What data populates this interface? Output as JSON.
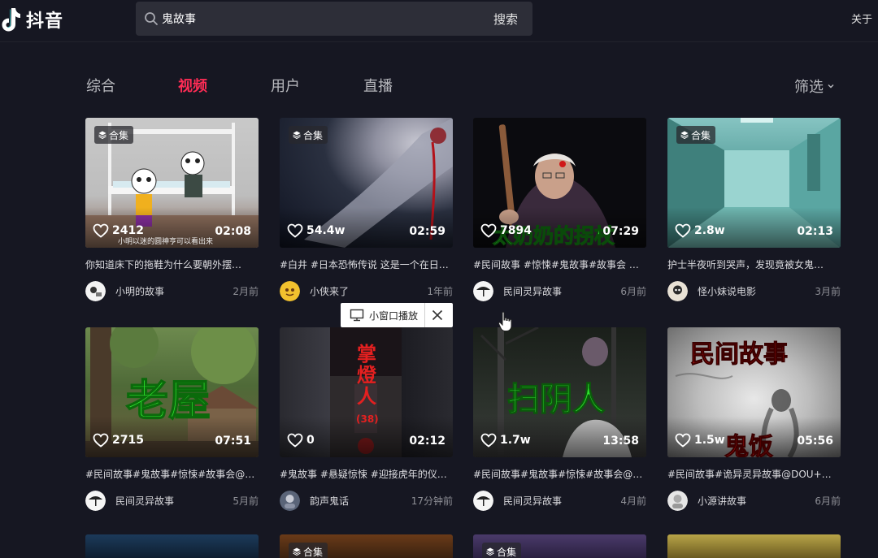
{
  "header": {
    "logo_text": "抖音",
    "search_value": "鬼故事",
    "search_button": "搜索",
    "about": "关于"
  },
  "tabs": [
    "综合",
    "视频",
    "用户",
    "直播"
  ],
  "active_tab": "视频",
  "filter_label": "筛选",
  "mini_player": {
    "label": "小窗口播放"
  },
  "badge_label": "合集",
  "videos": [
    {
      "likes": "2412",
      "duration": "02:08",
      "caption": "你知道床下的拖鞋为什么要朝外摆…",
      "author": "小明的故事",
      "time": "2月前",
      "badge": true,
      "overlay": "",
      "subtitle": "小明以迷的圆神亨可以看出来"
    },
    {
      "likes": "54.4w",
      "duration": "02:59",
      "caption": "#白井 #日本恐怖传说 这是一个在日…",
      "author": "小侠来了",
      "time": "1年前",
      "badge": true,
      "overlay": "",
      "subtitle": ""
    },
    {
      "likes": "7894",
      "duration": "07:29",
      "caption": "#民间故事 #惊悚#鬼故事#故事会 …",
      "author": "民间灵异故事",
      "time": "6月前",
      "badge": false,
      "overlay": "太奶奶的拐杖",
      "subtitle": ""
    },
    {
      "likes": "2.8w",
      "duration": "02:13",
      "caption": "护士半夜听到哭声，发现竟被女鬼…",
      "author": "怪小妹说电影",
      "time": "3月前",
      "badge": true,
      "overlay": "",
      "subtitle": ""
    },
    {
      "likes": "2715",
      "duration": "07:51",
      "caption": "#民间故事#鬼故事#惊悚#故事会@…",
      "author": "民间灵异故事",
      "time": "5月前",
      "badge": false,
      "overlay": "老屋",
      "subtitle": ""
    },
    {
      "likes": "0",
      "duration": "02:12",
      "caption": "#鬼故事 #悬疑惊悚 #迎接虎年的仪…",
      "author": "韵声鬼话",
      "time": "17分钟前",
      "badge": false,
      "overlay": "掌燈人",
      "subtitle": "(38)"
    },
    {
      "likes": "1.7w",
      "duration": "13:58",
      "caption": "#民间故事#鬼故事#惊悚#故事会@…",
      "author": "民间灵异故事",
      "time": "4月前",
      "badge": false,
      "overlay": "扫阴人",
      "subtitle": ""
    },
    {
      "likes": "1.5w",
      "duration": "05:56",
      "caption": "#民间故事#诡异灵异故事@DOU+…",
      "author": "小源讲故事",
      "time": "6月前",
      "badge": false,
      "overlay": "民间故事",
      "subtitle": "鬼饭"
    }
  ],
  "partial_row": [
    {
      "badge": false,
      "overlay": ""
    },
    {
      "badge": true,
      "overlay": ""
    },
    {
      "badge": true,
      "overlay": ""
    },
    {
      "badge": false,
      "overlay": ""
    }
  ],
  "colors": {
    "accent": "#fe2c55",
    "background": "#161722",
    "search_bg": "#2d2e38"
  }
}
